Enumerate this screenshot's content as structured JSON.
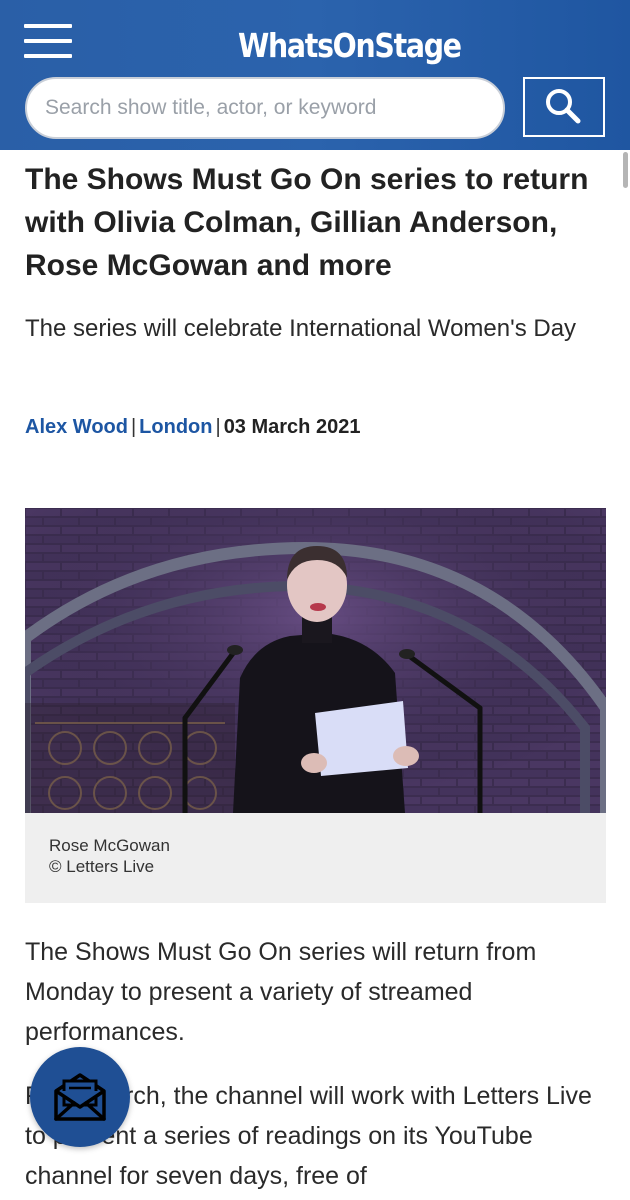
{
  "header": {
    "logo_text": "WhatsOnStage",
    "search_placeholder": "Search show title, actor, or keyword",
    "menu_icon": "hamburger-icon",
    "search_icon": "search-icon",
    "color": "#2b63ad"
  },
  "article": {
    "title": "The Shows Must Go On series to return with Olivia Colman, Gillian Anderson, Rose McGowan and more",
    "subtitle": "The series will celebrate International Women's Day",
    "author": "Alex Wood",
    "location": "London",
    "date": "03 March 2021",
    "image": {
      "caption_name": "Rose McGowan",
      "caption_credit": "© Letters Live"
    },
    "paragraphs": [
      "The Shows Must Go On series will return from Monday to present a variety of streamed performances.",
      "From March, the channel will work with Letters Live to present a series of readings on its YouTube channel for seven days, free of"
    ]
  },
  "newsletter": {
    "icon": "envelope-icon"
  }
}
